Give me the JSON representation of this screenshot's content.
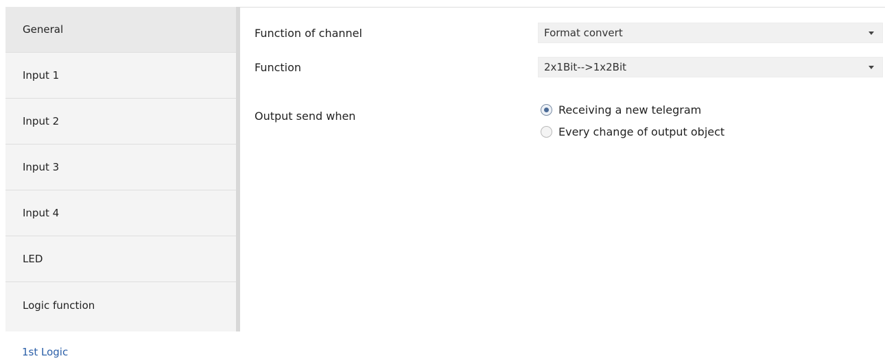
{
  "sidebar": {
    "items": [
      {
        "label": "General",
        "active": true
      },
      {
        "label": "Input 1"
      },
      {
        "label": "Input 2"
      },
      {
        "label": "Input 3"
      },
      {
        "label": "Input 4"
      },
      {
        "label": "LED"
      },
      {
        "label": "Logic function"
      }
    ]
  },
  "tree": {
    "current_item": "1st Logic"
  },
  "params": {
    "function_of_channel": {
      "label": "Function of channel",
      "value": "Format convert"
    },
    "function": {
      "label": "Function",
      "value": "2x1Bit-->1x2Bit"
    },
    "output_send_when": {
      "label": "Output send when",
      "options": [
        {
          "label": "Receiving a new telegram",
          "checked": true
        },
        {
          "label": "Every change of output object",
          "checked": false
        }
      ]
    }
  },
  "colors": {
    "link_blue": "#2b5fa8",
    "sidebar_bg": "#f4f4f4",
    "select_bg": "#f1f1f1"
  }
}
